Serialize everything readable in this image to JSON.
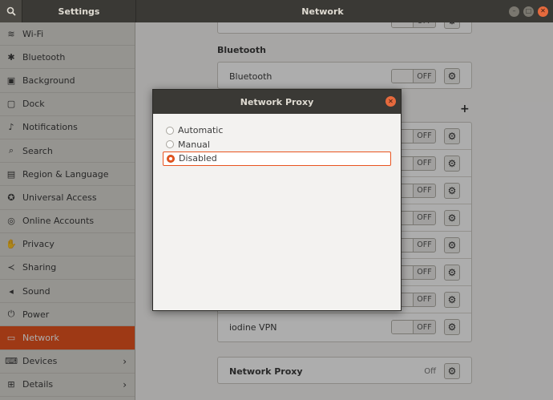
{
  "header": {
    "left_title": "Settings",
    "main_title": "Network",
    "search_icon": "search-icon"
  },
  "sidebar": {
    "items": [
      {
        "label": "Wi-Fi",
        "icon": "≋"
      },
      {
        "label": "Bluetooth",
        "icon": "✱"
      },
      {
        "label": "Background",
        "icon": "▣"
      },
      {
        "label": "Dock",
        "icon": "▢"
      },
      {
        "label": "Notifications",
        "icon": "♪"
      },
      {
        "label": "Search",
        "icon": "⌕"
      },
      {
        "label": "Region & Language",
        "icon": "▤"
      },
      {
        "label": "Universal Access",
        "icon": "✪"
      },
      {
        "label": "Online Accounts",
        "icon": "◎"
      },
      {
        "label": "Privacy",
        "icon": "✋"
      },
      {
        "label": "Sharing",
        "icon": "≺"
      },
      {
        "label": "Sound",
        "icon": "◂"
      },
      {
        "label": "Power",
        "icon": "⏻"
      },
      {
        "label": "Network",
        "icon": "▭"
      },
      {
        "label": "Devices",
        "icon": "⌨"
      },
      {
        "label": "Details",
        "icon": "⊞"
      }
    ]
  },
  "main": {
    "bluetooth_section": "Bluetooth",
    "bluetooth_row": "Bluetooth",
    "toggle_off": "OFF",
    "vpn_last": "iodine VPN",
    "proxy_label": "Network Proxy",
    "proxy_state": "Off"
  },
  "dialog": {
    "title": "Network Proxy",
    "options": [
      "Automatic",
      "Manual",
      "Disabled"
    ],
    "selected": "Disabled"
  },
  "colors": {
    "accent": "#e95420",
    "header": "#3a3935"
  }
}
